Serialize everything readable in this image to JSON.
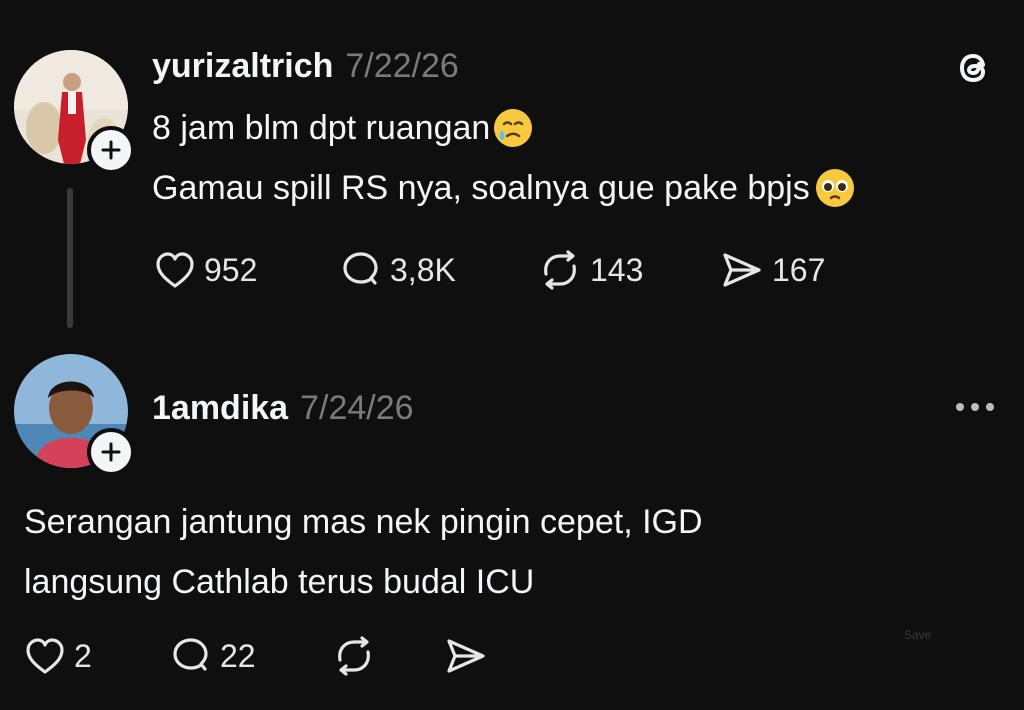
{
  "post": {
    "username": "yurizaltrich",
    "date": "7/22/26",
    "lines": [
      "8 jam blm dpt ruangan",
      "Gamau spill RS nya, soalnya gue pake bpjs"
    ],
    "likes": "952",
    "replies": "3,8K",
    "reposts": "143",
    "shares": "167"
  },
  "reply": {
    "username": "1amdika",
    "date": "7/24/26",
    "lines": [
      "Serangan jantung mas nek pingin cepet, IGD",
      "langsung Cathlab terus budal ICU"
    ],
    "likes": "2",
    "replies": "22"
  },
  "watermark": "Save",
  "icons": {
    "logo": "threads-logo-icon",
    "follow": "plus-icon",
    "like": "heart-icon",
    "reply": "comment-icon",
    "repost": "repost-icon",
    "share": "send-icon",
    "more": "more-icon"
  }
}
